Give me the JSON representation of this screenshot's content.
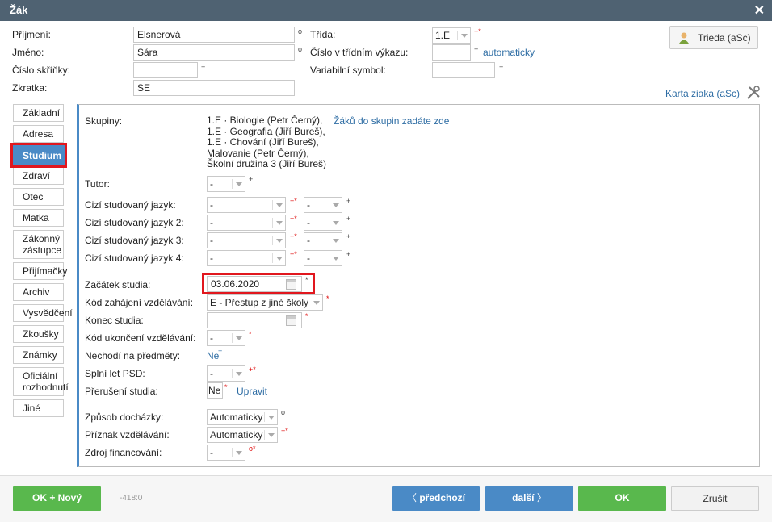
{
  "dialog": {
    "title": "Žák",
    "close": "✕"
  },
  "header": {
    "surname_label": "Příjmení:",
    "surname_value": "Elsnerová",
    "name_label": "Jméno:",
    "name_value": "Sára",
    "locker_label": "Číslo skříňky:",
    "abbr_label": "Zkratka:",
    "abbr_value": "SE",
    "class_label": "Třída:",
    "class_value": "1.E",
    "classlist_label": "Číslo v třídním výkazu:",
    "auto_link": "automaticky",
    "varsym_label": "Variabilní symbol:",
    "class_button": "Trieda (aSc)",
    "card_link": "Karta ziaka (aSc)",
    "mark_circle": "o",
    "mark_plus": "+",
    "mark_plusstar": "+*",
    "mark_star": "*",
    "mark_circlestar": "o*"
  },
  "tabs": [
    {
      "label": "Základní"
    },
    {
      "label": "Adresa"
    },
    {
      "label": "Studium"
    },
    {
      "label": "Zdraví"
    },
    {
      "label": "Otec"
    },
    {
      "label": "Matka"
    },
    {
      "label": "Zákonný zástupce"
    },
    {
      "label": "Přijímačky"
    },
    {
      "label": "Archiv"
    },
    {
      "label": "Vysvědčení"
    },
    {
      "label": "Zkoušky"
    },
    {
      "label": "Známky"
    },
    {
      "label": "Oficiální rozhodnutí"
    },
    {
      "label": "Jiné"
    }
  ],
  "study": {
    "groups_label": "Skupiny:",
    "groups": [
      "1.E · Biologie (Petr Černý),",
      "1.E · Geografia (Jiří Bureš),",
      "1.E · Chování (Jiří Bureš),",
      "Malovanie (Petr Černý),",
      "Školní družina 3 (Jiří Bureš)"
    ],
    "groups_link": "Žáků do skupin zadáte zde",
    "tutor_label": "Tutor:",
    "dash": "-",
    "lang1_label": "Cizí studovaný jazyk:",
    "lang2_label": "Cizí studovaný jazyk 2:",
    "lang3_label": "Cizí studovaný jazyk 3:",
    "lang4_label": "Cizí studovaný jazyk 4:",
    "start_label": "Začátek studia:",
    "start_value": "03.06.2020",
    "start_code_label": "Kód zahájení vzdělávání:",
    "start_code_value": "E - Přestup z jiné školy",
    "end_label": "Konec studia:",
    "end_code_label": "Kód ukončení vzdělávání:",
    "not_attend_label": "Nechodí na předměty:",
    "not_attend_value": "Ne",
    "psd_label": "Splní let PSD:",
    "interrupt_label": "Přerušení studia:",
    "interrupt_value": "Ne",
    "edit_link": "Upravit",
    "attendance_label": "Způsob docházky:",
    "attendance_value": "Automaticky",
    "edu_flag_label": "Příznak vzdělávání:",
    "edu_flag_value": "Automaticky",
    "funding_label": "Zdroj financování:"
  },
  "footer": {
    "ok_new": "OK + Nový",
    "code": "-418:0",
    "prev": "předchozí",
    "next": "další",
    "ok": "OK",
    "cancel": "Zrušit",
    "prev_arrow": "〈",
    "next_arrow": "〉"
  }
}
